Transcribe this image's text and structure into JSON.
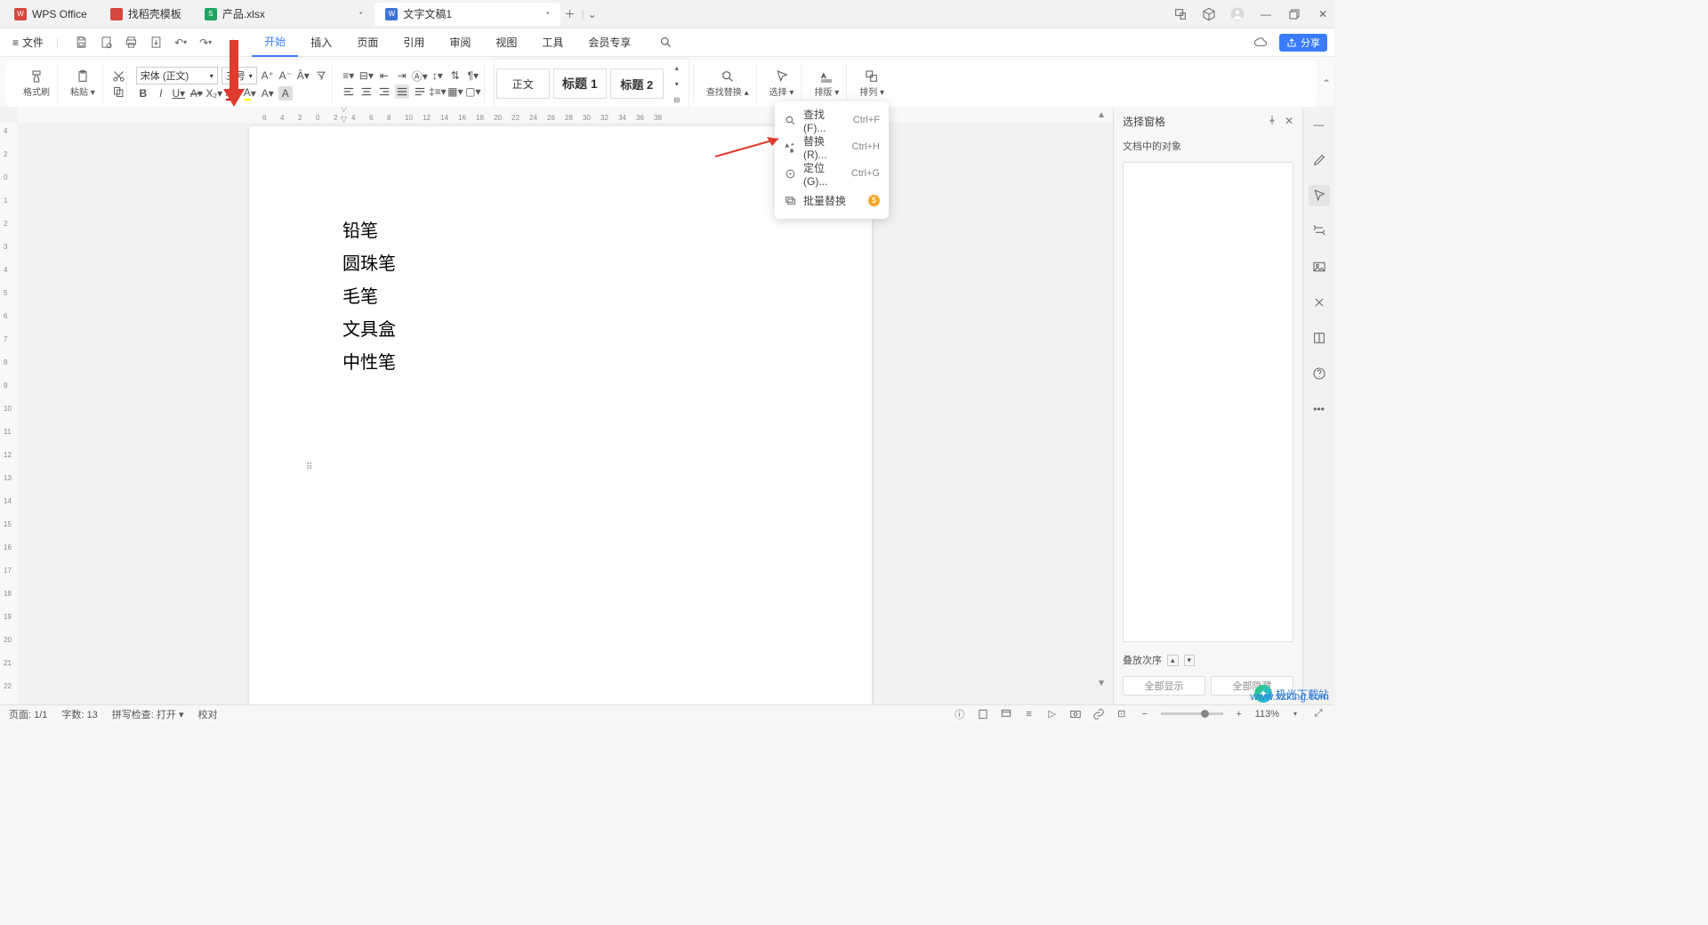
{
  "title_tabs": [
    {
      "label": "WPS Office",
      "icon_color": "#d6483f",
      "is_app": true
    },
    {
      "label": "找稻壳模板",
      "icon_color": "#d6483f"
    },
    {
      "label": "产品.xlsx",
      "icon_color": "#1fa463"
    },
    {
      "label": "文字文稿1",
      "icon_color": "#3f74d6",
      "active": true
    }
  ],
  "menu": {
    "file": "文件",
    "tabs": [
      "开始",
      "插入",
      "页面",
      "引用",
      "审阅",
      "视图",
      "工具",
      "会员专享"
    ],
    "active_tab": "开始",
    "share": "分享"
  },
  "ribbon": {
    "format_paint": "格式刷",
    "paste": "粘贴",
    "font_name": "宋体 (正文)",
    "font_size": "三号",
    "styles": {
      "body": "正文",
      "h1": "标题 1",
      "h2": "标题 2"
    },
    "find_replace": "查找替换",
    "select": "选择",
    "pane": "排版",
    "arrange": "排列"
  },
  "dropdown": {
    "items": [
      {
        "icon": "search",
        "label": "查找(F)...",
        "shortcut": "Ctrl+F"
      },
      {
        "icon": "replace",
        "label": "替换(R)...",
        "shortcut": "Ctrl+H"
      },
      {
        "icon": "locate",
        "label": "定位(G)...",
        "shortcut": "Ctrl+G"
      },
      {
        "icon": "batch",
        "label": "批量替换",
        "badge": "$"
      }
    ]
  },
  "document": {
    "lines": [
      "铅笔",
      "圆珠笔",
      "毛笔",
      "文具盒",
      "中性笔"
    ]
  },
  "ruler": {
    "h_marks": [
      6,
      4,
      2,
      0,
      2,
      4,
      6,
      8,
      10,
      12,
      14,
      16,
      18,
      20,
      22,
      24,
      26,
      28,
      30,
      32,
      34,
      36,
      38
    ],
    "v_marks": [
      4,
      2,
      0,
      1,
      2,
      3,
      4,
      5,
      6,
      7,
      8,
      9,
      10,
      11,
      12,
      13,
      14,
      15,
      16,
      17,
      18,
      19,
      20,
      21,
      22
    ]
  },
  "panel": {
    "title": "选择窗格",
    "subtitle": "文档中的对象",
    "stack_order": "叠放次序",
    "show_all": "全部显示",
    "hide_all": "全部隐藏"
  },
  "status": {
    "page": "页面: 1/1",
    "words": "字数: 13",
    "spelling": "拼写检查: 打开",
    "proof": "校对",
    "zoom": "113%"
  },
  "watermark": {
    "brand": "极光下载站",
    "url": "www.xzking.com"
  }
}
